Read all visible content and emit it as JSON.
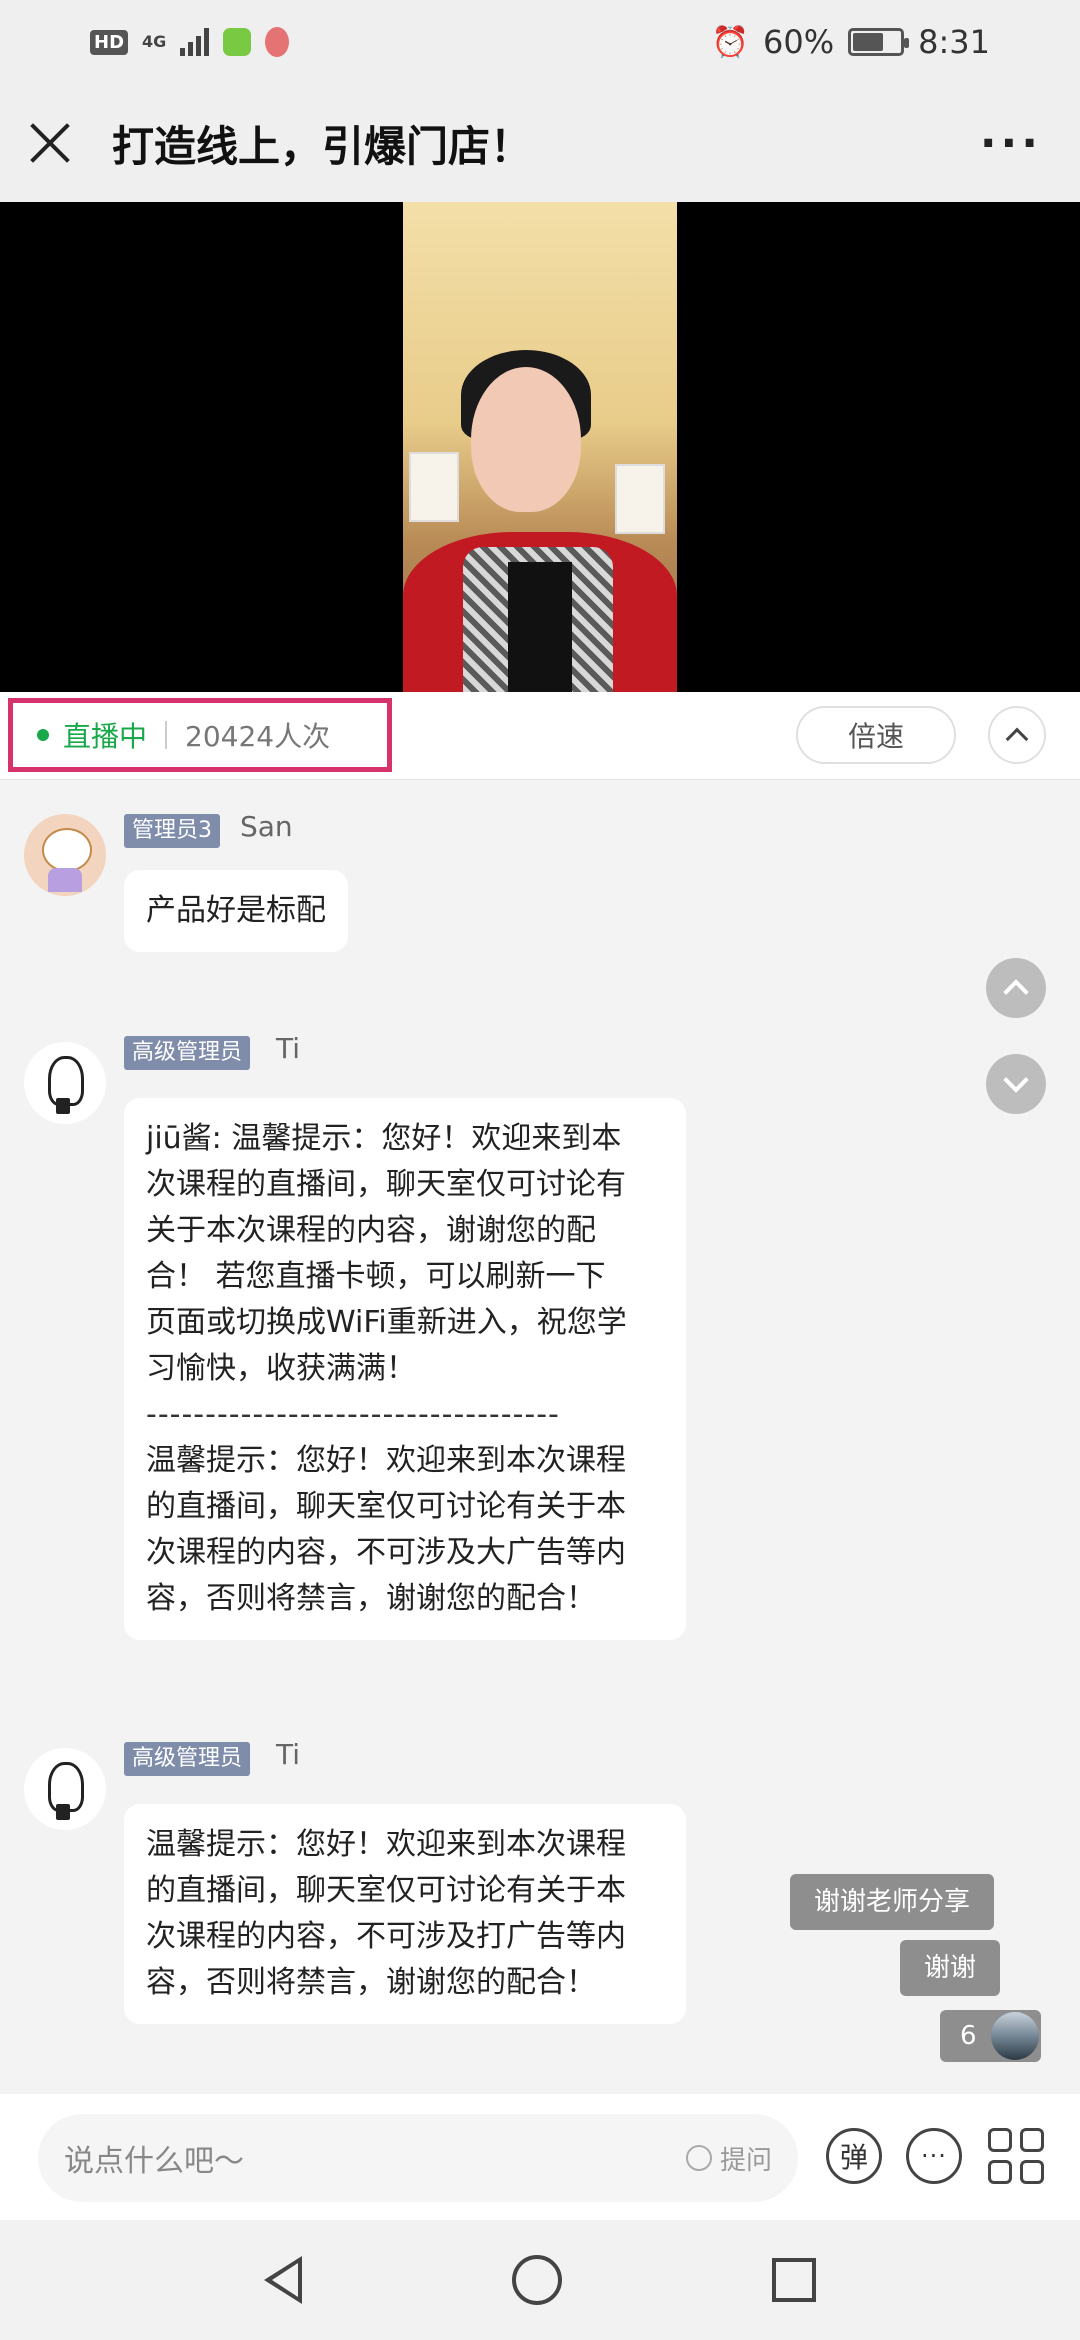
{
  "status_bar": {
    "left_chip": "HD",
    "signal": "4G",
    "battery_pct": "60%",
    "time": "8:31"
  },
  "header": {
    "title": "打造线上，引爆门店！"
  },
  "live_bar": {
    "status": "直播中",
    "viewers": "20424人次",
    "speed_label": "倍速"
  },
  "messages": [
    {
      "tag": "管理员3",
      "name": "San",
      "lines": [
        "产品好是标配"
      ]
    },
    {
      "tag": "高级管理员",
      "name": "Ti",
      "lines": [
        "jiū酱: 温馨提示：您好！欢迎来到本",
        "次课程的直播间，聊天室仅可讨论有",
        "关于本次课程的内容，谢谢您的配",
        "合！ 若您直播卡顿，可以刷新一下",
        "页面或切换成WiFi重新进入，祝您学",
        "习愉快，收获满满！"
      ],
      "divider": "-----------------------------------",
      "lines2": [
        "温馨提示：您好！欢迎来到本次课程",
        "的直播间，聊天室仅可讨论有关于本",
        "次课程的内容，不可涉及大广告等内",
        "容，否则将禁言，谢谢您的配合！"
      ]
    },
    {
      "tag": "高级管理员",
      "name": "Ti",
      "lines": [
        "温馨提示：您好！欢迎来到本次课程",
        "的直播间，聊天室仅可讨论有关于本",
        "次课程的内容，不可涉及打广告等内",
        "容，否则将禁言，谢谢您的配合！"
      ]
    }
  ],
  "danmaku": [
    "谢谢老师分享",
    "谢谢"
  ],
  "likes_count": "6",
  "input": {
    "placeholder": "说点什么吧～",
    "ask_label": "提问",
    "danmaku_toggle": "弹"
  }
}
